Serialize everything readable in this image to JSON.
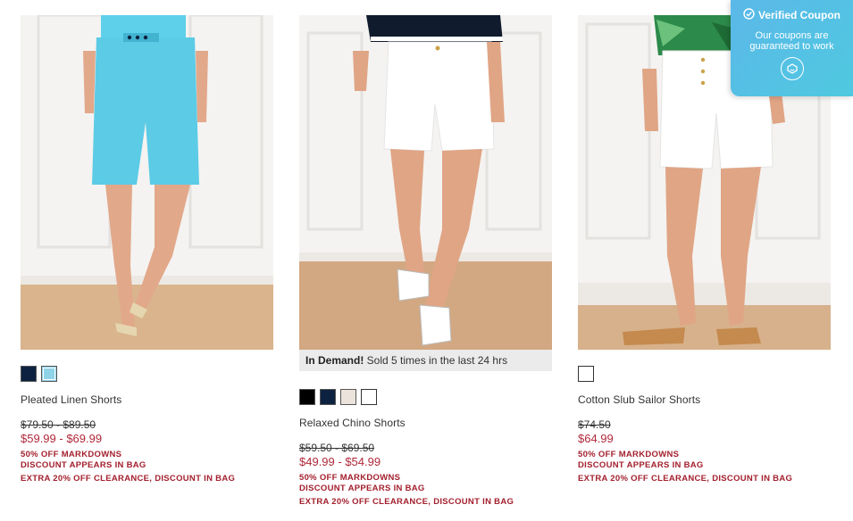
{
  "products": [
    {
      "name": "Pleated Linen Shorts",
      "badge": null,
      "swatches": [
        {
          "color": "#0d2240",
          "selected": false
        },
        {
          "color": "#8fd3e8",
          "selected": true
        }
      ],
      "original_price": "$79.50 - $89.50",
      "sale_price": "$59.99 - $69.99",
      "promo_1": "50% OFF MARKDOWNS",
      "promo_2": "DISCOUNT APPEARS IN BAG",
      "promo_3": "EXTRA 20% OFF CLEARANCE, DISCOUNT IN BAG"
    },
    {
      "name": "Relaxed Chino Shorts",
      "badge_bold": "In Demand!",
      "badge_text": " Sold 5 times in the last 24 hrs",
      "swatches": [
        {
          "color": "#000000",
          "selected": false
        },
        {
          "color": "#0d2240",
          "selected": false
        },
        {
          "color": "#ece4dc",
          "selected": false
        },
        {
          "color": "#ffffff",
          "selected": false
        }
      ],
      "original_price": "$59.50 - $69.50",
      "sale_price": "$49.99 - $54.99",
      "promo_1": "50% OFF MARKDOWNS",
      "promo_2": "DISCOUNT APPEARS IN BAG",
      "promo_3": "EXTRA 20% OFF CLEARANCE, DISCOUNT IN BAG"
    },
    {
      "name": "Cotton Slub Sailor Shorts",
      "badge": null,
      "swatches": [
        {
          "color": "#ffffff",
          "selected": false
        }
      ],
      "original_price": "$74.50",
      "sale_price": "$64.99",
      "promo_1": "50% OFF MARKDOWNS",
      "promo_2": "DISCOUNT APPEARS IN BAG",
      "promo_3": "EXTRA 20% OFF CLEARANCE, DISCOUNT IN BAG"
    }
  ],
  "coupon": {
    "title": "Verified Coupon",
    "line1": "Our coupons are",
    "line2": "guaranteed to work",
    "icons": [
      "check-circle-icon",
      "coupon-logo-icon"
    ]
  },
  "colors": {
    "sale": "#b0283a",
    "promo": "#a3202e",
    "coupon_bg": "#55c0e4"
  }
}
